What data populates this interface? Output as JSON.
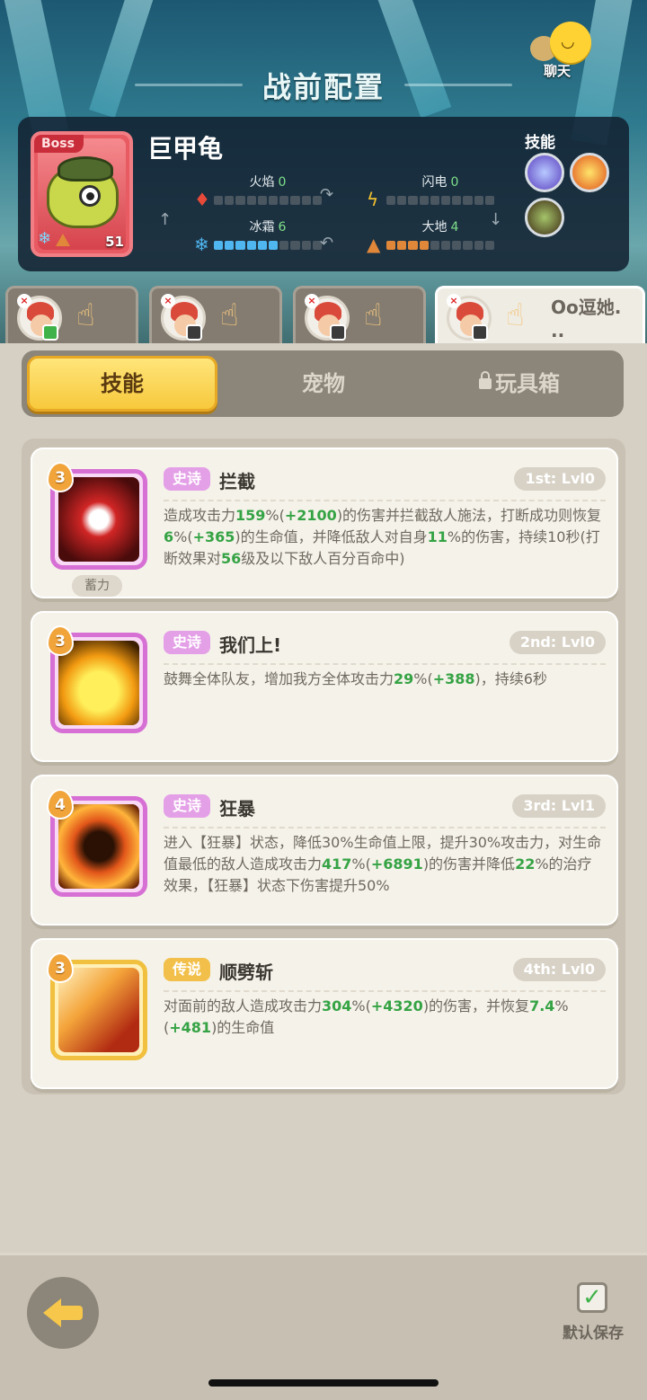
{
  "screen": {
    "title": "战前配置",
    "chat_label": "聊天"
  },
  "boss": {
    "tag": "Boss",
    "name": "巨甲龟",
    "level": "51",
    "stats": [
      {
        "label": "火焰",
        "value": "0",
        "fill": 0,
        "color": "#e84a3a",
        "icon": "fire-icon"
      },
      {
        "label": "闪电",
        "value": "0",
        "fill": 0,
        "color": "#f2c12e",
        "icon": "lightning-icon"
      },
      {
        "label": "冰霜",
        "value": "6",
        "fill": 6,
        "color": "#4fb6f0",
        "icon": "snowflake-icon"
      },
      {
        "label": "大地",
        "value": "4",
        "fill": 4,
        "color": "#e0873a",
        "icon": "earth-icon"
      }
    ],
    "skills_label": "技能"
  },
  "hero_tabs": [
    {
      "name": "",
      "active": false,
      "badge": "green"
    },
    {
      "name": "",
      "active": false,
      "badge": "dark"
    },
    {
      "name": "",
      "active": false,
      "badge": "dark"
    },
    {
      "name": "Oo逗她.\n..",
      "active": true,
      "badge": "dark"
    }
  ],
  "segments": {
    "skills": "技能",
    "pets": "宠物",
    "toybox": "玩具箱",
    "active": "skills"
  },
  "skills": [
    {
      "cost": "3",
      "rarity": "史诗",
      "rarity_type": "epic",
      "name": "拦截",
      "slot_level": "1st: Lvl0",
      "tag": "蓄力",
      "desc_parts": [
        {
          "t": "造成攻击力"
        },
        {
          "t": "159",
          "g": true
        },
        {
          "t": "%("
        },
        {
          "t": "+2100",
          "g": true
        },
        {
          "t": ")的伤害并拦截敌人施法，打断成功则恢复"
        },
        {
          "t": "6",
          "g": true
        },
        {
          "t": "%("
        },
        {
          "t": "+365",
          "g": true
        },
        {
          "t": ")的生命值，并降低敌人对自身"
        },
        {
          "t": "11",
          "g": true
        },
        {
          "t": "%的伤害，持续10秒(打断效果对"
        },
        {
          "t": "56",
          "g": true
        },
        {
          "t": "级及以下敌人百分百命中)"
        }
      ]
    },
    {
      "cost": "3",
      "rarity": "史诗",
      "rarity_type": "epic",
      "name": "我们上!",
      "slot_level": "2nd: Lvl0",
      "tag": "",
      "desc_parts": [
        {
          "t": "鼓舞全体队友，增加我方全体攻击力"
        },
        {
          "t": "29",
          "g": true
        },
        {
          "t": "%("
        },
        {
          "t": "+388",
          "g": true
        },
        {
          "t": ")，持续6秒"
        }
      ]
    },
    {
      "cost": "4",
      "rarity": "史诗",
      "rarity_type": "epic",
      "name": "狂暴",
      "slot_level": "3rd: Lvl1",
      "tag": "",
      "desc_parts": [
        {
          "t": "进入【狂暴】状态，降低30%生命值上限，提升30%攻击力，对生命值最低的敌人造成攻击力"
        },
        {
          "t": "417",
          "g": true
        },
        {
          "t": "%("
        },
        {
          "t": "+6891",
          "g": true
        },
        {
          "t": ")的伤害并降低"
        },
        {
          "t": "22",
          "g": true
        },
        {
          "t": "%的治疗效果，【狂暴】状态下伤害提升50%"
        }
      ]
    },
    {
      "cost": "3",
      "rarity": "传说",
      "rarity_type": "legend",
      "name": "顺劈斩",
      "slot_level": "4th: Lvl0",
      "tag": "",
      "desc_parts": [
        {
          "t": "对面前的敌人造成攻击力"
        },
        {
          "t": "304",
          "g": true
        },
        {
          "t": "%("
        },
        {
          "t": "+4320",
          "g": true
        },
        {
          "t": ")的伤害，并恢复"
        },
        {
          "t": "7.4",
          "g": true
        },
        {
          "t": "%("
        },
        {
          "t": "+481",
          "g": true
        },
        {
          "t": ")的生命值"
        }
      ]
    }
  ],
  "bottom": {
    "save_label": "默认保存",
    "save_checked": true
  }
}
